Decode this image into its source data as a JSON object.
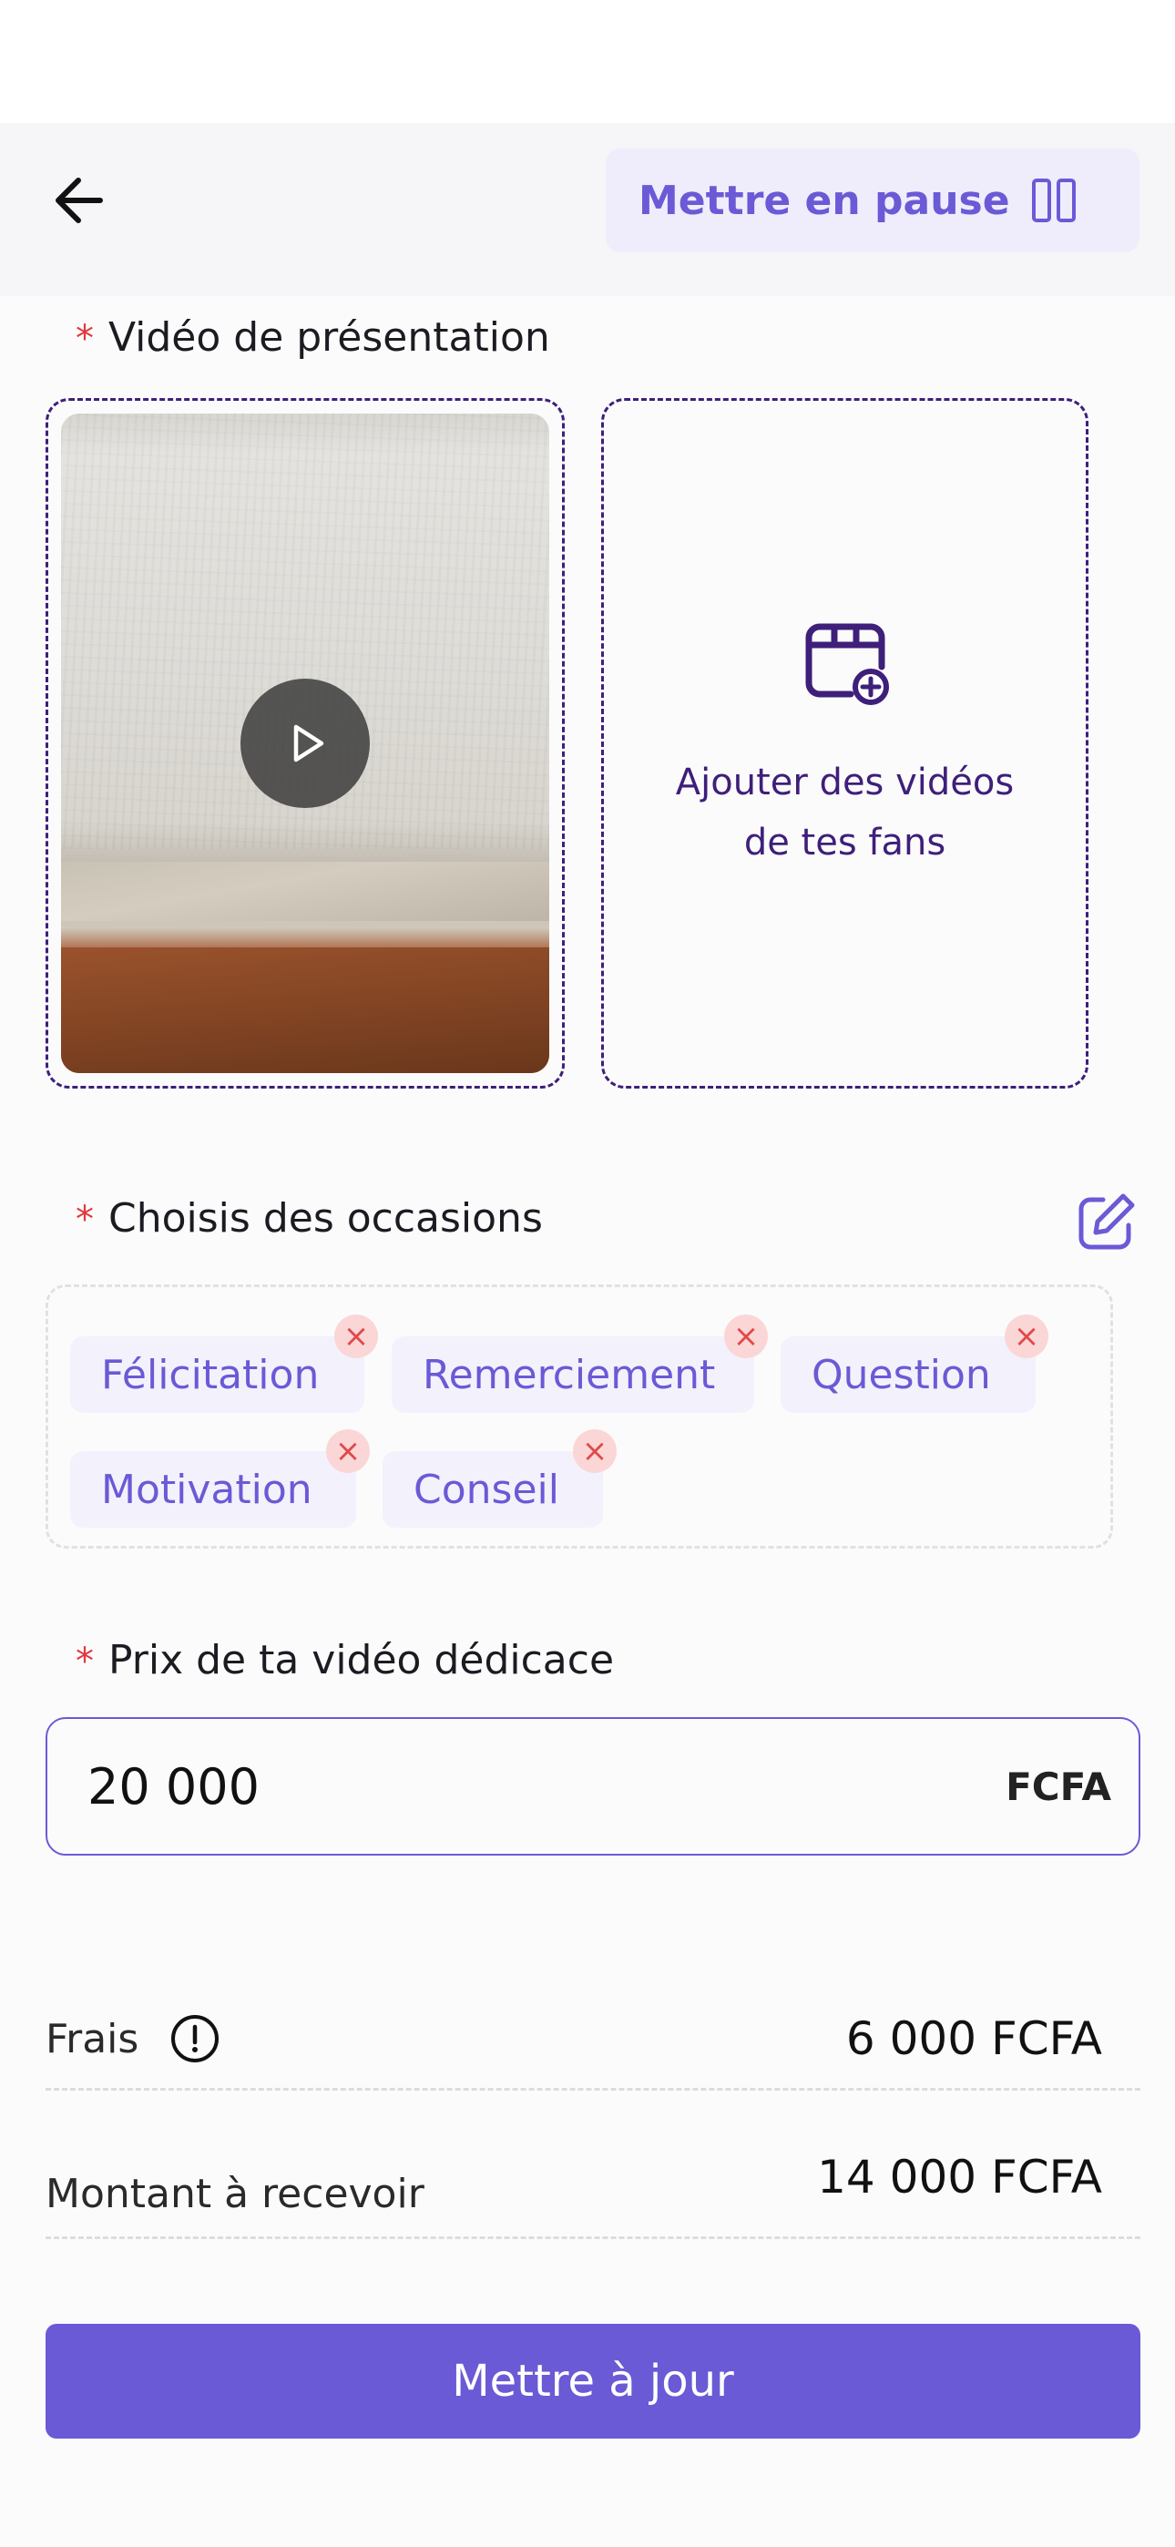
{
  "header": {
    "pause_label": "Mettre en pause"
  },
  "video_section": {
    "required_mark": "*",
    "label": "Vidéo de présentation",
    "add_label": "Ajouter des vidéos de tes fans"
  },
  "occasions": {
    "required_mark": "*",
    "label": "Choisis des occasions",
    "chips": [
      "Félicitation",
      "Remerciement",
      "Question",
      "Motivation",
      "Conseil"
    ],
    "remove_glyph": "×"
  },
  "price": {
    "required_mark": "*",
    "label": "Prix de ta vidéo dédicace",
    "value": "20 000",
    "unit": "FCFA"
  },
  "summary": {
    "fees_label": "Frais",
    "fees_value": "6 000 FCFA",
    "receive_label": "Montant à recevoir",
    "receive_value": "14 000 FCFA"
  },
  "actions": {
    "update_label": "Mettre à jour"
  },
  "colors": {
    "accent": "#6a5ad6",
    "dark_purple": "#3e1f7a",
    "required": "#e0393e",
    "chip_bg": "#f3f1fb",
    "remove_bg": "#fbd6d6"
  }
}
